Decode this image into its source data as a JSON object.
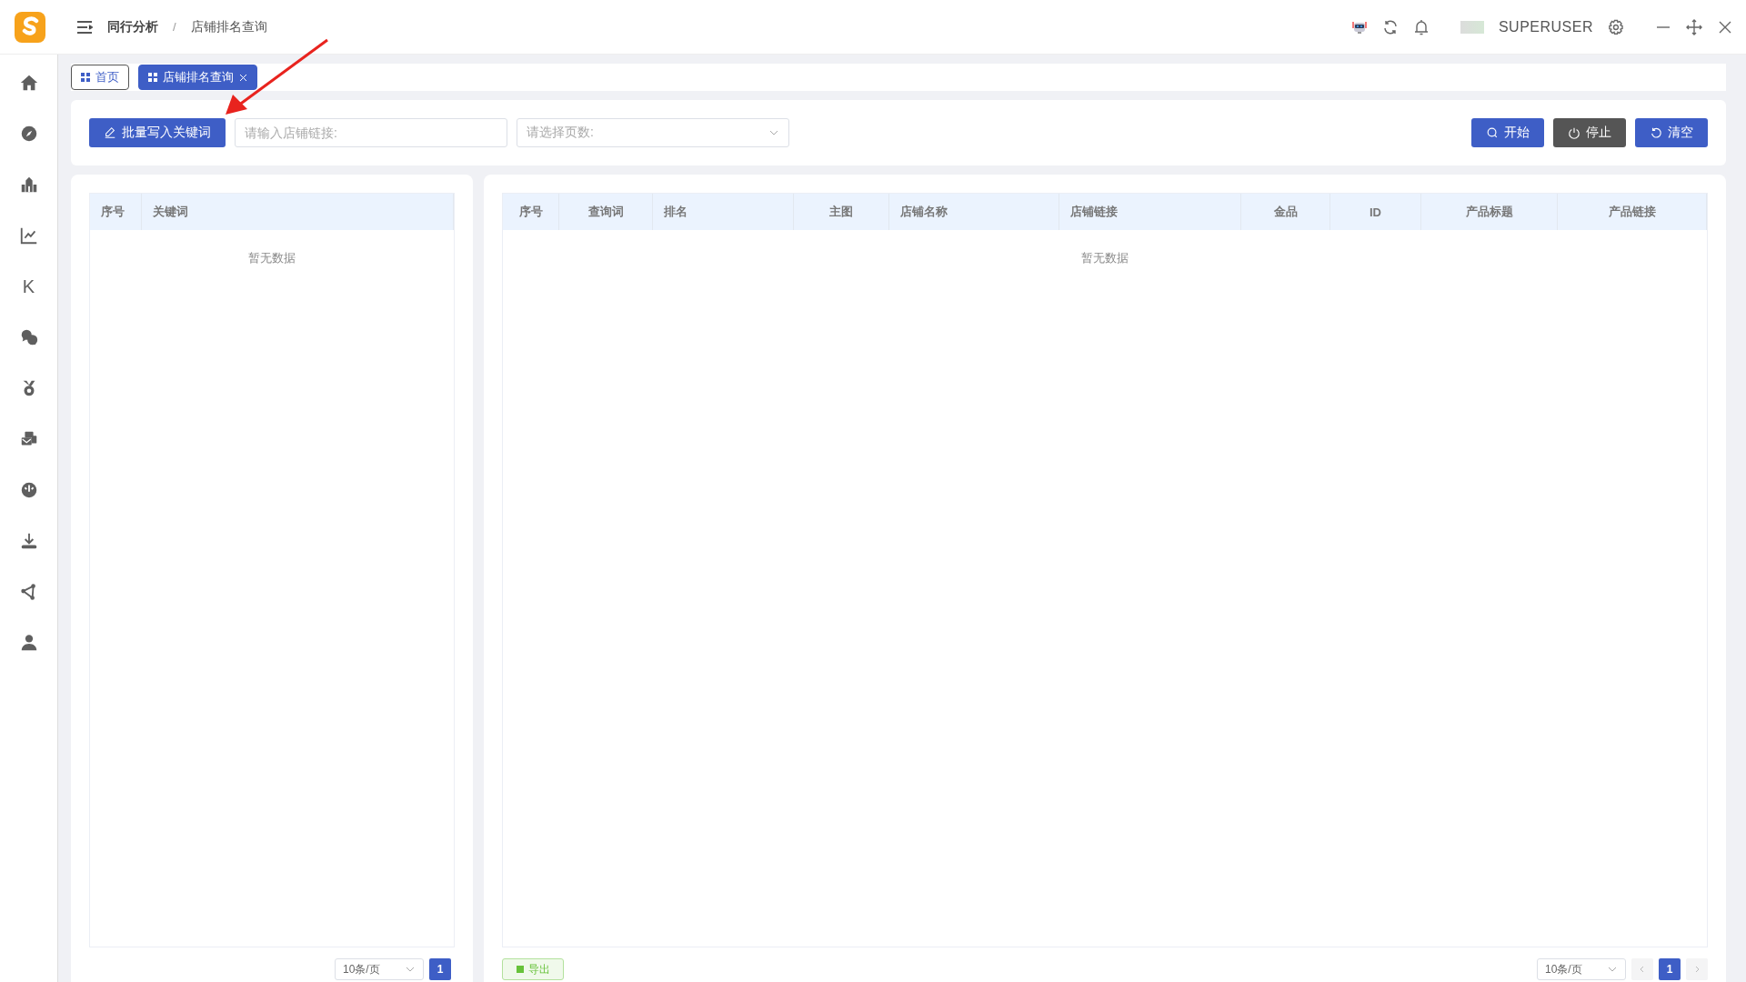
{
  "header": {
    "breadcrumb": [
      "同行分析",
      "店铺排名查询"
    ],
    "breadcrumb_separator": "/",
    "username": "SUPERUSER"
  },
  "sidebar": {
    "items": [
      {
        "kind": "home"
      },
      {
        "kind": "compass"
      },
      {
        "kind": "building"
      },
      {
        "kind": "chart"
      },
      {
        "kind": "letter",
        "text": "K"
      },
      {
        "kind": "chat"
      },
      {
        "kind": "medal"
      },
      {
        "kind": "cards"
      },
      {
        "kind": "gauge"
      },
      {
        "kind": "download"
      },
      {
        "kind": "nodes"
      },
      {
        "kind": "user"
      }
    ]
  },
  "tabs": [
    {
      "label": "首页",
      "selected": false,
      "closable": false
    },
    {
      "label": "店铺排名查询",
      "selected": true,
      "closable": true
    }
  ],
  "toolbar": {
    "batch_button": "批量写入关键词",
    "link_field": {
      "placeholder": "请输入店铺链接:"
    },
    "pages_select": {
      "placeholder": "请选择页数:"
    },
    "actions": [
      {
        "kind": "start",
        "label": "开始"
      },
      {
        "kind": "stop",
        "label": "停止"
      },
      {
        "kind": "clear",
        "label": "清空"
      }
    ]
  },
  "keyword_table": {
    "columns": [
      "序号",
      "关键词"
    ],
    "empty_text": "暂无数据",
    "pagination": {
      "page_size": "10条/页",
      "pages": [
        {
          "label": "1",
          "selected": true
        }
      ]
    }
  },
  "result_table": {
    "columns": [
      "序号",
      "查询词",
      "排名",
      "主图",
      "店铺名称",
      "店铺链接",
      "金品",
      "ID",
      "产品标题",
      "产品链接"
    ],
    "empty_text": "暂无数据",
    "export_button": "导出",
    "pagination": {
      "page_size": "10条/页",
      "pages": [
        {
          "label": "1",
          "selected": true
        }
      ]
    }
  }
}
